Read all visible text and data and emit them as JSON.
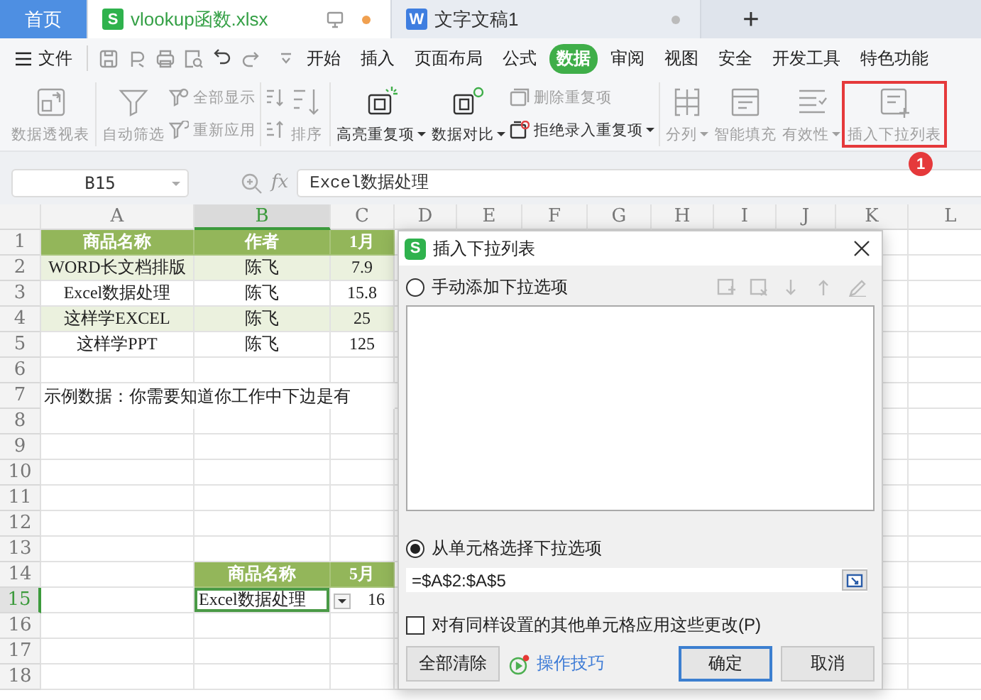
{
  "doc_tabs": [
    {
      "kind": "home",
      "label": "首页",
      "selected": false
    },
    {
      "kind": "sheet",
      "app_letter": "S",
      "label": "vlookup函数.xlsx",
      "selected": true,
      "modified": true
    },
    {
      "kind": "writer",
      "app_letter": "W",
      "label": "文字文稿1",
      "selected": false,
      "modified": false
    }
  ],
  "new_tab_button": "+",
  "menu": {
    "file_label": "文件",
    "tabs": [
      {
        "label": "开始",
        "selected": false
      },
      {
        "label": "插入",
        "selected": false
      },
      {
        "label": "页面布局",
        "selected": false
      },
      {
        "label": "公式",
        "selected": false
      },
      {
        "label": "数据",
        "selected": true
      },
      {
        "label": "审阅",
        "selected": false
      },
      {
        "label": "视图",
        "selected": false
      },
      {
        "label": "安全",
        "selected": false
      },
      {
        "label": "开发工具",
        "selected": false
      },
      {
        "label": "特色功能",
        "selected": false
      }
    ]
  },
  "ribbon": {
    "groups": [
      {
        "buttons": [
          {
            "kind": "large",
            "label": "数据透视表",
            "disabled": true
          }
        ]
      },
      {
        "buttons": [
          {
            "kind": "large",
            "label": "自动筛选",
            "disabled": true
          },
          {
            "kind": "small",
            "label": "全部显示",
            "disabled": true
          },
          {
            "kind": "small",
            "label": "重新应用",
            "disabled": true
          }
        ]
      },
      {
        "buttons": [
          {
            "kind": "icon",
            "disabled": true
          },
          {
            "kind": "icon",
            "disabled": true
          },
          {
            "kind": "large",
            "label": "排序",
            "disabled": true
          }
        ]
      },
      {
        "buttons": [
          {
            "kind": "large",
            "label": "高亮重复项",
            "disabled": false,
            "dropdown": true
          },
          {
            "kind": "large",
            "label": "数据对比",
            "disabled": false,
            "dropdown": true
          },
          {
            "kind": "small",
            "label": "删除重复项",
            "disabled": true
          },
          {
            "kind": "small",
            "label": "拒绝录入重复项",
            "disabled": false,
            "dropdown": true
          }
        ]
      },
      {
        "buttons": [
          {
            "kind": "large",
            "label": "分列",
            "disabled": true,
            "dropdown": true
          },
          {
            "kind": "large",
            "label": "智能填充",
            "disabled": true
          },
          {
            "kind": "large",
            "label": "有效性",
            "disabled": true,
            "dropdown": true
          },
          {
            "kind": "large",
            "label": "插入下拉列表",
            "disabled": true,
            "highlighted": true
          }
        ]
      }
    ]
  },
  "callout_badge": "1",
  "formula_bar": {
    "name_box": "B15",
    "fx": "fx",
    "content": "Excel数据处理"
  },
  "sheet": {
    "columns": [
      {
        "label": "A",
        "selected": false
      },
      {
        "label": "B",
        "selected": true
      },
      {
        "label": "C",
        "selected": false
      },
      {
        "label": "D",
        "selected": false
      },
      {
        "label": "E",
        "selected": false
      },
      {
        "label": "F",
        "selected": false
      },
      {
        "label": "G",
        "selected": false
      },
      {
        "label": "H",
        "selected": false
      },
      {
        "label": "I",
        "selected": false
      },
      {
        "label": "J",
        "selected": false
      },
      {
        "label": "K",
        "selected": false
      },
      {
        "label": "L",
        "selected": false
      }
    ],
    "rows": [
      {
        "label": "1",
        "selected": false,
        "cells": [
          {
            "kind": "header",
            "text": "商品名称"
          },
          {
            "kind": "header",
            "text": "作者"
          },
          {
            "kind": "header",
            "text": "1月"
          }
        ]
      },
      {
        "label": "2",
        "selected": false,
        "cells": [
          {
            "kind": "band",
            "text": "WORD长文档排版"
          },
          {
            "kind": "band",
            "text": "陈飞"
          },
          {
            "kind": "band",
            "text": "7.9"
          }
        ]
      },
      {
        "label": "3",
        "selected": false,
        "cells": [
          {
            "kind": "plain",
            "text": "Excel数据处理"
          },
          {
            "kind": "plain",
            "text": "陈飞"
          },
          {
            "kind": "plain",
            "text": "15.8"
          }
        ]
      },
      {
        "label": "4",
        "selected": false,
        "cells": [
          {
            "kind": "band",
            "text": "这样学EXCEL"
          },
          {
            "kind": "band",
            "text": "陈飞"
          },
          {
            "kind": "band",
            "text": "25"
          }
        ]
      },
      {
        "label": "5",
        "selected": false,
        "cells": [
          {
            "kind": "plain",
            "text": "这样学PPT"
          },
          {
            "kind": "plain",
            "text": "陈飞"
          },
          {
            "kind": "plain",
            "text": "125"
          }
        ]
      },
      {
        "label": "6",
        "selected": false
      },
      {
        "label": "7",
        "selected": false,
        "cells": [
          {
            "kind": "note",
            "text": "示例数据：你需要知道你工作中下边是有"
          }
        ]
      },
      {
        "label": "8",
        "selected": false
      },
      {
        "label": "9",
        "selected": false
      },
      {
        "label": "10",
        "selected": false
      },
      {
        "label": "11",
        "selected": false
      },
      {
        "label": "12",
        "selected": false
      },
      {
        "label": "13",
        "selected": false
      },
      {
        "label": "14",
        "selected": false,
        "cells": [
          {
            "kind": "blank"
          },
          {
            "kind": "header",
            "text": "商品名称"
          },
          {
            "kind": "header",
            "text": "5月"
          }
        ]
      },
      {
        "label": "15",
        "selected": true,
        "cells": [
          {
            "kind": "blank"
          },
          {
            "kind": "dropdown",
            "text": "Excel数据处理",
            "selected": true
          },
          {
            "kind": "number",
            "text": "16"
          }
        ]
      },
      {
        "label": "16",
        "selected": false
      },
      {
        "label": "17",
        "selected": false
      },
      {
        "label": "18",
        "selected": false
      }
    ]
  },
  "dialog": {
    "app_letter": "S",
    "title": "插入下拉列表",
    "manual_option": {
      "label": "手动添加下拉选项",
      "selected": false
    },
    "list_toolbar": {
      "disabled": true
    },
    "cell_option": {
      "label": "从单元格选择下拉选项",
      "selected": true
    },
    "range": {
      "value": "=$A$2:$A$5"
    },
    "apply_all": {
      "label": "对有同样设置的其他单元格应用这些更改(P)",
      "checked": false
    },
    "clear_button": "全部清除",
    "tips_link": "操作技巧",
    "ok_button": "确定",
    "cancel_button": "取消"
  }
}
